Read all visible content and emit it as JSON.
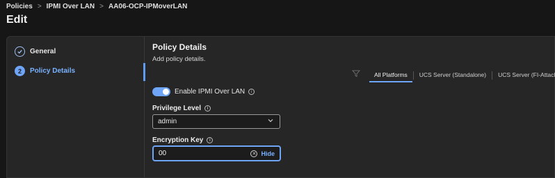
{
  "breadcrumb": {
    "items": [
      "Policies",
      "IPMI Over LAN",
      "AA06-OCP-IPMoverLAN"
    ],
    "separator": ">"
  },
  "page": {
    "title": "Edit"
  },
  "steps": [
    {
      "number": "1",
      "label": "General",
      "status": "completed"
    },
    {
      "number": "2",
      "label": "Policy Details",
      "status": "active"
    }
  ],
  "section": {
    "title": "Policy Details",
    "subtitle": "Add policy details."
  },
  "platform_tabs": {
    "items": [
      "All Platforms",
      "UCS Server (Standalone)",
      "UCS Server (FI-Attached)"
    ],
    "active": "All Platforms"
  },
  "enable_toggle": {
    "label": "Enable IPMI Over LAN",
    "state": "on"
  },
  "privilege_level": {
    "label": "Privilege Level",
    "value": "admin"
  },
  "encryption_key": {
    "label": "Encryption Key",
    "value": "00",
    "hide_label": "Hide"
  },
  "icons": {
    "info": "info-icon",
    "filter": "filter-icon",
    "clear": "clear-icon",
    "check": "check-icon",
    "chevron": "chevron-down-icon"
  },
  "colors": {
    "accent": "#6ea5f7",
    "background": "#161616",
    "panel": "#262626"
  }
}
